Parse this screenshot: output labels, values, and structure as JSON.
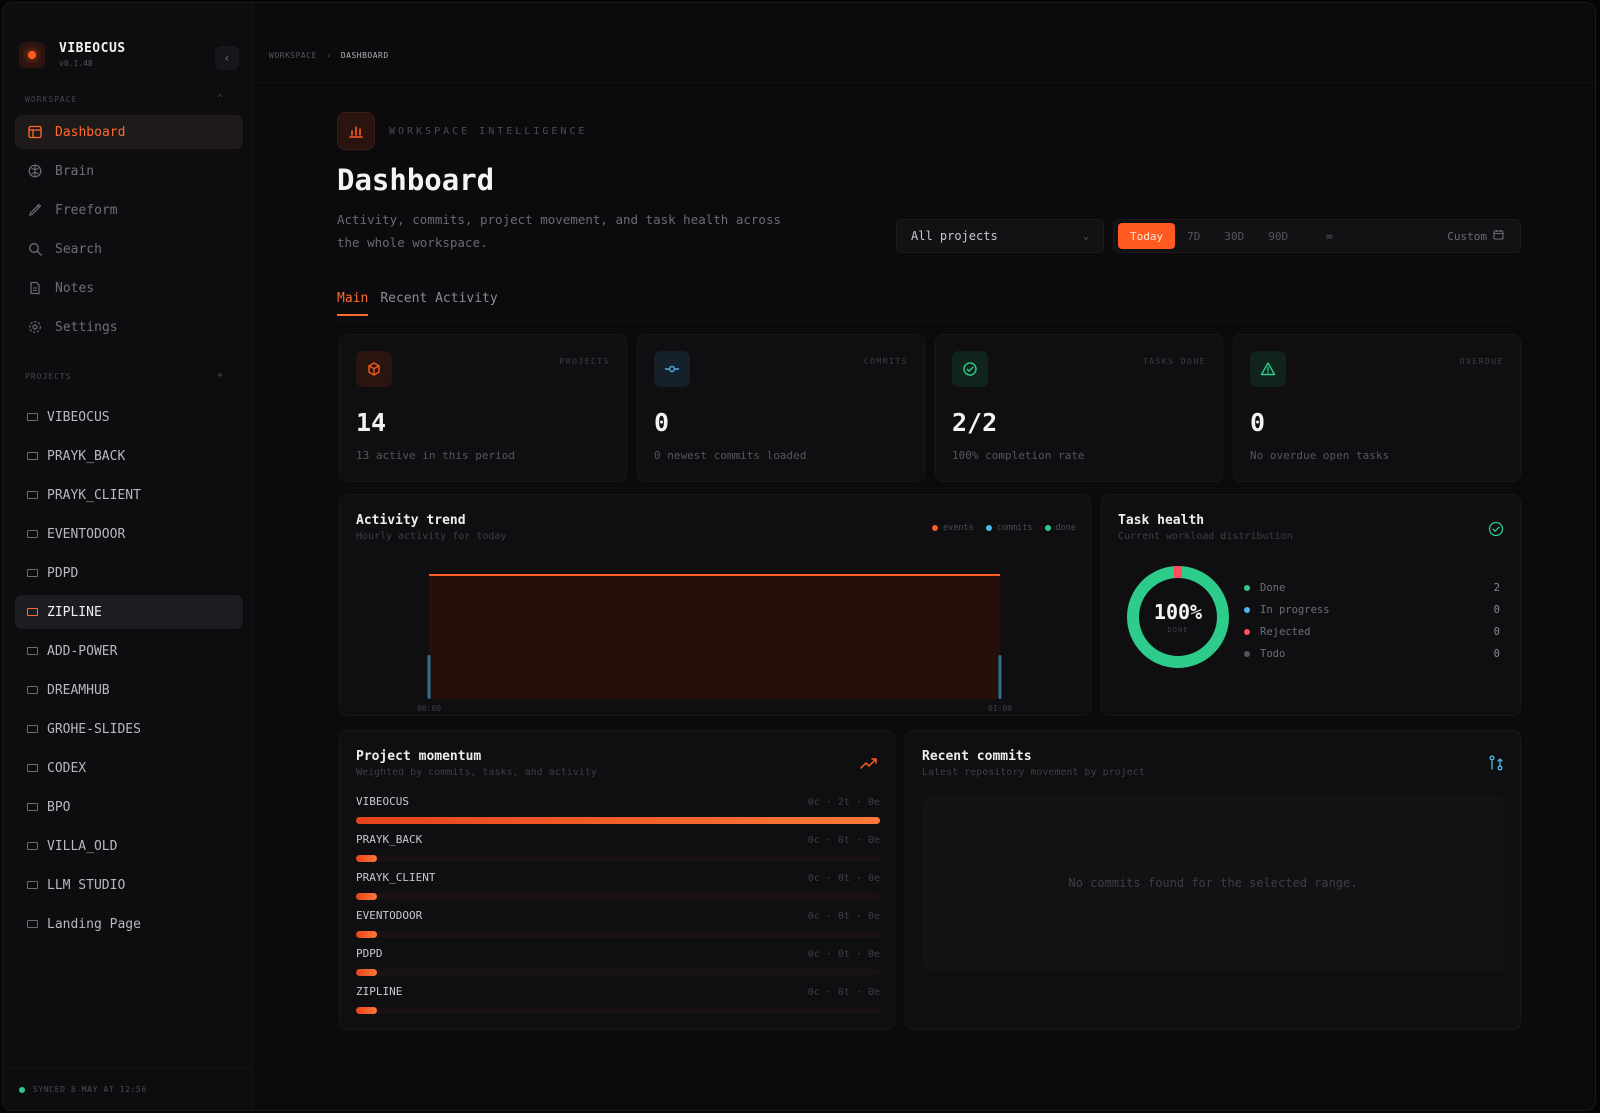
{
  "app": {
    "name": "VIBEOCUS",
    "version": "v0.1.48"
  },
  "sidebar": {
    "workspace_label": "WORKSPACE",
    "nav": [
      {
        "label": "Dashboard",
        "icon": "dashboard-icon",
        "active": true
      },
      {
        "label": "Brain",
        "icon": "brain-icon",
        "active": false
      },
      {
        "label": "Freeform",
        "icon": "pen-icon",
        "active": false
      },
      {
        "label": "Search",
        "icon": "search-icon",
        "active": false
      },
      {
        "label": "Notes",
        "icon": "note-icon",
        "active": false
      },
      {
        "label": "Settings",
        "icon": "gear-icon",
        "active": false
      }
    ],
    "projects_label": "PROJECTS",
    "projects": [
      {
        "label": "VIBEOCUS",
        "active": false
      },
      {
        "label": "PRAYK_BACK",
        "active": false
      },
      {
        "label": "PRAYK_CLIENT",
        "active": false
      },
      {
        "label": "EVENTODOOR",
        "active": false
      },
      {
        "label": "PDPD",
        "active": false
      },
      {
        "label": "ZIPLINE",
        "active": true
      },
      {
        "label": "ADD-POWER",
        "active": false
      },
      {
        "label": "DREAMHUB",
        "active": false
      },
      {
        "label": "GROHE-SLIDES",
        "active": false
      },
      {
        "label": "CODEX",
        "active": false
      },
      {
        "label": "BPO",
        "active": false
      },
      {
        "label": "VILLA_OLD",
        "active": false
      },
      {
        "label": "LLM STUDIO",
        "active": false
      },
      {
        "label": "Landing Page",
        "active": false
      }
    ],
    "sync_text": "SYNCED 8 MAY AT 12:56"
  },
  "breadcrumb": {
    "root": "WORKSPACE",
    "separator": "›",
    "current": "DASHBOARD"
  },
  "header": {
    "eyebrow": "WORKSPACE INTELLIGENCE",
    "title": "Dashboard",
    "subtitle": "Activity, commits, project movement, and task health across the whole workspace."
  },
  "filters": {
    "project_select": "All projects",
    "ranges": [
      "Today",
      "7D",
      "30D",
      "90D",
      "∞"
    ],
    "active_range": "Today",
    "custom_label": "Custom"
  },
  "tabs": [
    {
      "label": "Main",
      "active": true
    },
    {
      "label": "Recent Activity",
      "active": false
    }
  ],
  "stats": [
    {
      "label": "PROJECTS",
      "value": "14",
      "sub": "13 active in this period",
      "icon": "cube-icon",
      "color": "#ff5a1f"
    },
    {
      "label": "COMMITS",
      "value": "0",
      "sub": "0 newest commits loaded",
      "icon": "commit-icon",
      "color": "#4fa8e0"
    },
    {
      "label": "TASKS DONE",
      "value": "2/2",
      "sub": "100% completion rate",
      "icon": "check-circle-icon",
      "color": "#2ecc8a"
    },
    {
      "label": "OVERDUE",
      "value": "0",
      "sub": "No overdue open tasks",
      "icon": "warning-icon",
      "color": "#2ecc8a"
    }
  ],
  "activity": {
    "title": "Activity trend",
    "subtitle": "Hourly activity for today",
    "legend": [
      {
        "label": "events",
        "color": "#ff5a1f"
      },
      {
        "label": "commits",
        "color": "#4fb8e8"
      },
      {
        "label": "done",
        "color": "#2ecc8a"
      }
    ],
    "x_start": "00:00",
    "x_end": "01:00"
  },
  "chart_data": {
    "type": "area",
    "x": [
      "00:00",
      "01:00"
    ],
    "series": [
      {
        "name": "events",
        "values": [
          1,
          1
        ]
      },
      {
        "name": "commits",
        "values": [
          0,
          0
        ]
      },
      {
        "name": "done",
        "values": [
          0,
          0
        ]
      }
    ],
    "title": "Activity trend",
    "ylim": [
      0,
      1
    ]
  },
  "health": {
    "title": "Task health",
    "subtitle": "Current workload distribution",
    "percent": "100%",
    "center_label": "DONE",
    "rows": [
      {
        "label": "Done",
        "value": "2",
        "color": "#2ecc8a"
      },
      {
        "label": "In progress",
        "value": "0",
        "color": "#4fb8e8"
      },
      {
        "label": "Rejected",
        "value": "0",
        "color": "#ff4d5e"
      },
      {
        "label": "Todo",
        "value": "0",
        "color": "#55555c"
      }
    ]
  },
  "momentum": {
    "title": "Project momentum",
    "subtitle": "Weighted by commits, tasks, and activity",
    "rows": [
      {
        "name": "VIBEOCUS",
        "stats": "0c · 2t · 0e",
        "level": 1.0
      },
      {
        "name": "PRAYK_BACK",
        "stats": "0c · 0t · 0e",
        "level": 0.04
      },
      {
        "name": "PRAYK_CLIENT",
        "stats": "0c · 0t · 0e",
        "level": 0.04
      },
      {
        "name": "EVENTODOOR",
        "stats": "0c · 0t · 0e",
        "level": 0.04
      },
      {
        "name": "PDPD",
        "stats": "0c · 0t · 0e",
        "level": 0.04
      },
      {
        "name": "ZIPLINE",
        "stats": "0c · 0t · 0e",
        "level": 0.04
      }
    ]
  },
  "commits": {
    "title": "Recent commits",
    "subtitle": "Latest repository movement by project",
    "empty": "No commits found for the selected range."
  }
}
